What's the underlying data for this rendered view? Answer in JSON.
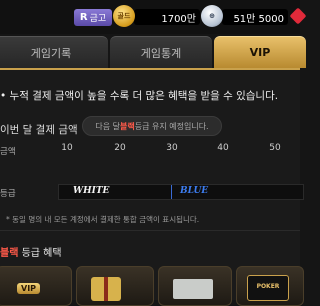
{
  "topbar": {
    "vault_prefix": "R",
    "vault_label": "금고",
    "gold_icon_text": "골드",
    "gold_amount": "1700만",
    "silver_amount": "51만 5000",
    "icons": [
      "gold-coin-icon",
      "silver-coin-icon",
      "ruby-icon"
    ]
  },
  "tabs": [
    {
      "label": "게임기록",
      "active": false
    },
    {
      "label": "게임통계",
      "active": false
    },
    {
      "label": "VIP",
      "active": true
    }
  ],
  "vip": {
    "notice": "• 누적 결제 금액이 높을 수록 더 많은 혜택을 받을 수 있습니다.",
    "this_month_label": "이번 달 결제 금액",
    "next_month_prefix": "다음 달 ",
    "next_month_grade": "블랙",
    "next_month_suffix": " 등급 유지 예정입니다.",
    "amount_label": "금액",
    "grade_label": "등급",
    "ticks": [
      "10",
      "20",
      "30",
      "40",
      "50"
    ],
    "grades": [
      {
        "name": "WHITE",
        "color": "#f5f5f5"
      },
      {
        "name": "BLUE",
        "color": "#3d7df0"
      }
    ],
    "footnote": "* 동일 명의 내 모든 계정에서 결제한 통합 금액이 표시됩니다.",
    "benefit_grade": "블랙",
    "benefit_suffix": " 등급 혜택",
    "cards": [
      {
        "label": "VIP"
      },
      {
        "label": ""
      },
      {
        "label": ""
      },
      {
        "label": "POKER"
      }
    ]
  },
  "colors": {
    "accent_gold": "#c9a14c",
    "grade_black_text": "#ff5a4a",
    "blue": "#3d7df0"
  }
}
